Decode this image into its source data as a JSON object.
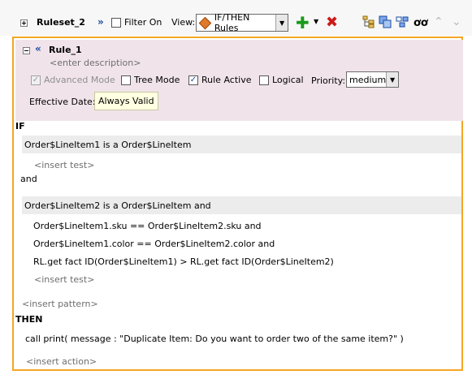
{
  "toolbar": {
    "ruleset_name": "Ruleset_2",
    "filter_label": "Filter On",
    "view_label": "View:",
    "view_value": "IF/THEN Rules",
    "icons": [
      "expand-icon",
      "collapse-all-icon",
      "add-icon",
      "delete-icon",
      "tree-icon",
      "copy-icon",
      "group-icon",
      "glasses-icon",
      "move-up-icon",
      "move-down-icon"
    ],
    "colors": {
      "add": "#1a9a1a",
      "delete": "#cc1a1a",
      "accent": "#f5a623"
    }
  },
  "rule": {
    "name": "Rule_1",
    "description_placeholder": "<enter description>",
    "advanced_mode_label": "Advanced Mode",
    "advanced_mode_checked": true,
    "tree_mode_label": "Tree Mode",
    "tree_mode_checked": false,
    "rule_active_label": "Rule Active",
    "rule_active_checked": true,
    "logical_label": "Logical",
    "logical_checked": false,
    "priority_label": "Priority:",
    "priority_value": "medium",
    "effective_date_label": "Effective Date:",
    "effective_date_value": "Always Valid"
  },
  "body": {
    "if_label": "IF",
    "pattern1": "Order$LineItem1 is a Order$LineItem",
    "insert_test1": "<insert test>",
    "and_label": "and",
    "pattern2": "Order$LineItem2 is a Order$LineItem  and",
    "tests": [
      "Order$LineItem1.sku  ==  Order$LineItem2.sku and",
      "Order$LineItem1.color  ==  Order$LineItem2.color and",
      "RL.get fact ID(Order$LineItem1)  >  RL.get fact ID(Order$LineItem2)"
    ],
    "insert_test2": "<insert test>",
    "insert_pattern": "<insert pattern>",
    "then_label": "THEN",
    "action": "call print( message : \"Duplicate Item: Do you want to order two of the same item?\" )",
    "insert_action": "<insert action>"
  }
}
